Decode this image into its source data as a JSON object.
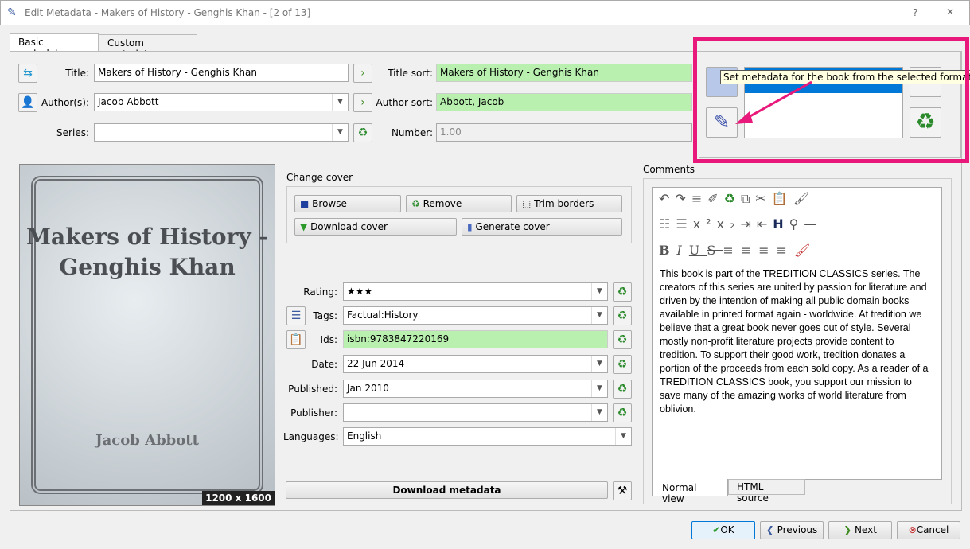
{
  "window": {
    "title": "Edit Metadata - Makers of History - Genghis Khan -  [2 of 13]",
    "help": "?",
    "close": "✕"
  },
  "tabs": [
    "Basic metadata",
    "Custom metadata"
  ],
  "fields": {
    "title_label": "Title:",
    "title": "Makers of History - Genghis Khan",
    "title_sort_label": "Title sort:",
    "title_sort": "Makers of History - Genghis Khan",
    "authors_label": "Author(s):",
    "authors": "Jacob Abbott",
    "author_sort_label": "Author sort:",
    "author_sort": "Abbott, Jacob",
    "series_label": "Series:",
    "series": "",
    "number_label": "Number:",
    "number": "1.00"
  },
  "cover": {
    "title": "Makers of History - Genghis Khan",
    "author": "Jacob Abbott",
    "size": "1200 x 1600"
  },
  "change_cover": {
    "label": "Change cover",
    "browse": "Browse",
    "remove": "Remove",
    "trim": "Trim borders",
    "download": "Download cover",
    "generate": "Generate cover"
  },
  "meta": {
    "rating_label": "Rating:",
    "rating": "★★★",
    "tags_label": "Tags:",
    "tags": "Factual:History",
    "ids_label": "Ids:",
    "ids": "isbn:9783847220169",
    "date_label": "Date:",
    "date": "22 Jun 2014",
    "published_label": "Published:",
    "published": "Jan 2010",
    "publisher_label": "Publisher:",
    "publisher": "",
    "languages_label": "Languages:",
    "languages": "English",
    "download_metadata": "Download metadata"
  },
  "formats": {
    "tooltip": "Set metadata for the book from the selected format"
  },
  "comments": {
    "label": "Comments",
    "text": "This book is part of the TREDITION CLASSICS series. The creators of this series are united by passion for literature and driven by the intention of making all public domain books available in printed format again - worldwide. At tredition we believe that a great book never goes out of style. Several mostly non-profit literature projects provide content to tredition. To support their good work, tredition donates a portion of the proceeds from each sold copy. As a reader of a TREDITION CLASSICS book, you support our mission to save many of the amazing works of world literature from oblivion.",
    "normal_view": "Normal view",
    "html_source": "HTML source"
  },
  "buttons": {
    "ok": "OK",
    "previous": "Previous",
    "next": "Next",
    "cancel": "Cancel"
  },
  "colors": {
    "highlight": "#e8197a",
    "green_field": "#b9f0b0",
    "selection": "#0078d7"
  }
}
